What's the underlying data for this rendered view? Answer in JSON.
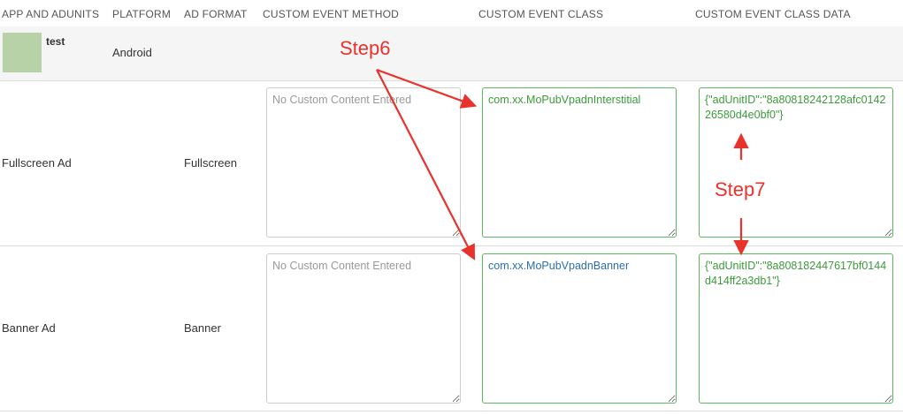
{
  "header": {
    "col_app": "APP AND ADUNITS",
    "col_platform": "PLATFORM",
    "col_format": "AD FORMAT",
    "col_method": "CUSTOM EVENT METHOD",
    "col_class": "CUSTOM EVENT CLASS",
    "col_class_data": "CUSTOM EVENT CLASS DATA"
  },
  "app": {
    "name": "test",
    "platform": "Android"
  },
  "ad_units": [
    {
      "name": "Fullscreen Ad",
      "format": "Fullscreen",
      "method_placeholder": "No Custom Content Entered",
      "event_class": "com.xx.MoPubVpadnInterstitial",
      "event_class_data": "{\"adUnitID\":\"8a80818242128afc014226580d4e0bf0\"}"
    },
    {
      "name": "Banner Ad",
      "format": "Banner",
      "method_placeholder": "No Custom Content Entered",
      "event_class": "com.xx.MoPubVpadnBanner",
      "event_class_data": "{\"adUnitID\":\"8a808182447617bf0144d414ff2a3db1\"}"
    }
  ],
  "annotations": {
    "step6": "Step6",
    "step7": "Step7",
    "color": "#e8322b"
  },
  "colors": {
    "valid_border": "#5cb85c",
    "valid_text": "#3c9a3c",
    "link_text": "#2a6fb0",
    "row_highlight": "#f5f5f5",
    "thumb": "#b8d2a7"
  }
}
